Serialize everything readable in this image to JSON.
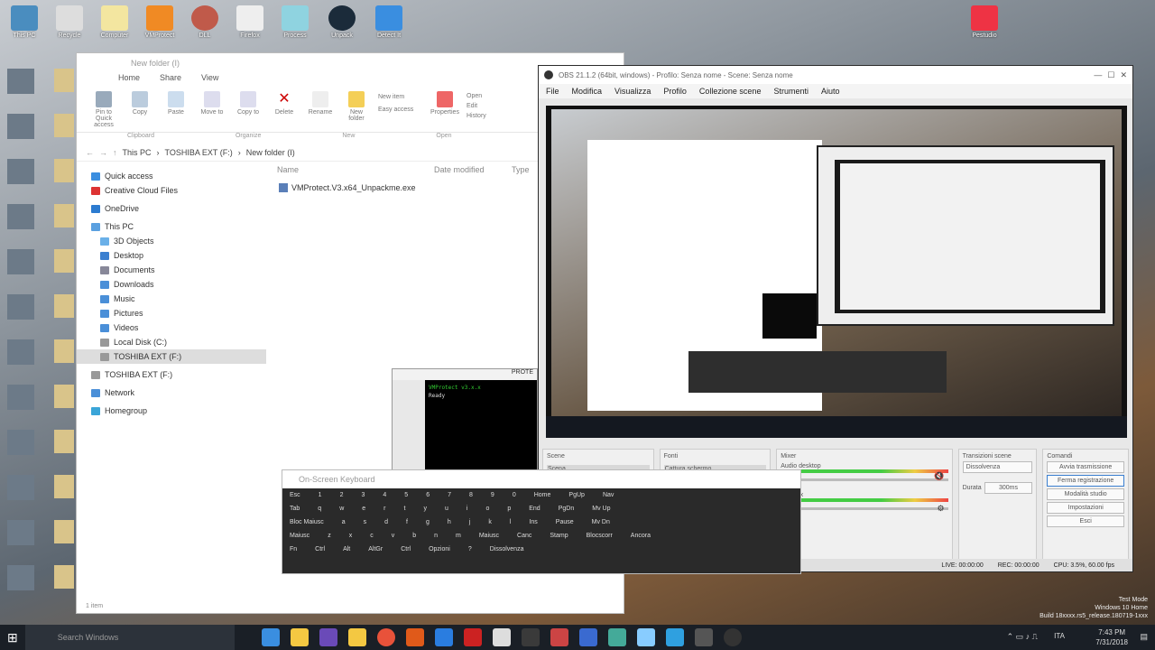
{
  "taskbar": {
    "search_placeholder": "Search Windows",
    "time": "7:43 PM",
    "date": "7/31/2018",
    "lang": "ITA"
  },
  "watermark": {
    "line1": "Test Mode",
    "line2": "Windows 10 Home",
    "line3": "Build 18xxxx.rs5_release.180719-1xxx"
  },
  "explorer": {
    "title": "New folder (I)",
    "tabs": [
      "Home",
      "Share",
      "View"
    ],
    "ribbon": [
      "Pin to Quick access",
      "Copy",
      "Paste",
      "Move to",
      "Copy to",
      "Delete",
      "Rename",
      "New folder",
      "Properties",
      "Open",
      "Edit",
      "History"
    ],
    "groups": [
      "Clipboard",
      "Organize",
      "New",
      "Open"
    ],
    "new_item": "New item",
    "easy_access": "Easy access",
    "path": [
      "This PC",
      "TOSHIBA EXT (F:)",
      "New folder (I)"
    ],
    "columns": [
      "Name",
      "Date modified",
      "Type"
    ],
    "file": "VMProtect.V3.x64_Unpackme.exe",
    "nav": [
      "Quick access",
      "Creative Cloud Files",
      "OneDrive",
      "This PC",
      "3D Objects",
      "Desktop",
      "Documents",
      "Downloads",
      "Music",
      "Pictures",
      "Videos",
      "Local Disk (C:)",
      "TOSHIBA EXT (F:)",
      "TOSHIBA EXT (F:)",
      "Network",
      "Homegroup"
    ],
    "status": "1 item"
  },
  "obs": {
    "title": "OBS 21.1.2 (64bit, windows) - Profilo: Senza nome - Scene: Senza nome",
    "menu": [
      "File",
      "Modifica",
      "Visualizza",
      "Profilo",
      "Collezione scene",
      "Strumenti",
      "Aiuto"
    ],
    "docks": {
      "scenes": "Scene",
      "sources": "Fonti",
      "mixer": "Mixer",
      "transitions": "Transizioni scene",
      "controls": "Comandi"
    },
    "scene_item": "Scena",
    "source_item": "Cattura schermo",
    "audio_desktop": "Audio desktop",
    "audio_mic": "Mic/Aux",
    "transition": "Dissolvenza",
    "duration_label": "Durata",
    "duration": "300ms",
    "buttons": [
      "Avvia trasmissione",
      "Ferma registrazione",
      "Modalità studio",
      "Impostazioni",
      "Esci"
    ],
    "status": {
      "live": "LIVE: 00:00:00",
      "rec": "REC: 00:00:00",
      "cpu": "CPU: 3.5%, 60.00 fps"
    }
  },
  "protect": {
    "title": "PROTE",
    "line1": "VMProtect v3.x.x",
    "line2": "Ready"
  },
  "keyboard": {
    "title": "On-Screen Keyboard",
    "rows": [
      [
        "Esc",
        "1",
        "2",
        "3",
        "4",
        "5",
        "6",
        "7",
        "8",
        "9",
        "0",
        "Home",
        "PgUp",
        "Nav"
      ],
      [
        "Tab",
        "q",
        "w",
        "e",
        "r",
        "t",
        "y",
        "u",
        "i",
        "o",
        "p",
        "End",
        "PgDn",
        "Mv Up"
      ],
      [
        "Bloc Maiusc",
        "a",
        "s",
        "d",
        "f",
        "g",
        "h",
        "j",
        "k",
        "l",
        "Ins",
        "Pause",
        "Mv Dn"
      ],
      [
        "Maiusc",
        "z",
        "x",
        "c",
        "v",
        "b",
        "n",
        "m",
        "Maiusc",
        "Canc",
        "Stamp",
        "Blocscorr",
        "Ancora"
      ],
      [
        "Fn",
        "Ctrl",
        "Alt",
        "AltGr",
        "Ctrl",
        "Opzioni",
        "?",
        "Dissolvenza"
      ]
    ]
  },
  "desktop_icons": [
    "This PC",
    "Recycle",
    "Computer",
    "VMProtect",
    "DLL",
    "Firefox",
    "Process",
    "Unpack",
    "Detect It",
    "Pestudio"
  ]
}
